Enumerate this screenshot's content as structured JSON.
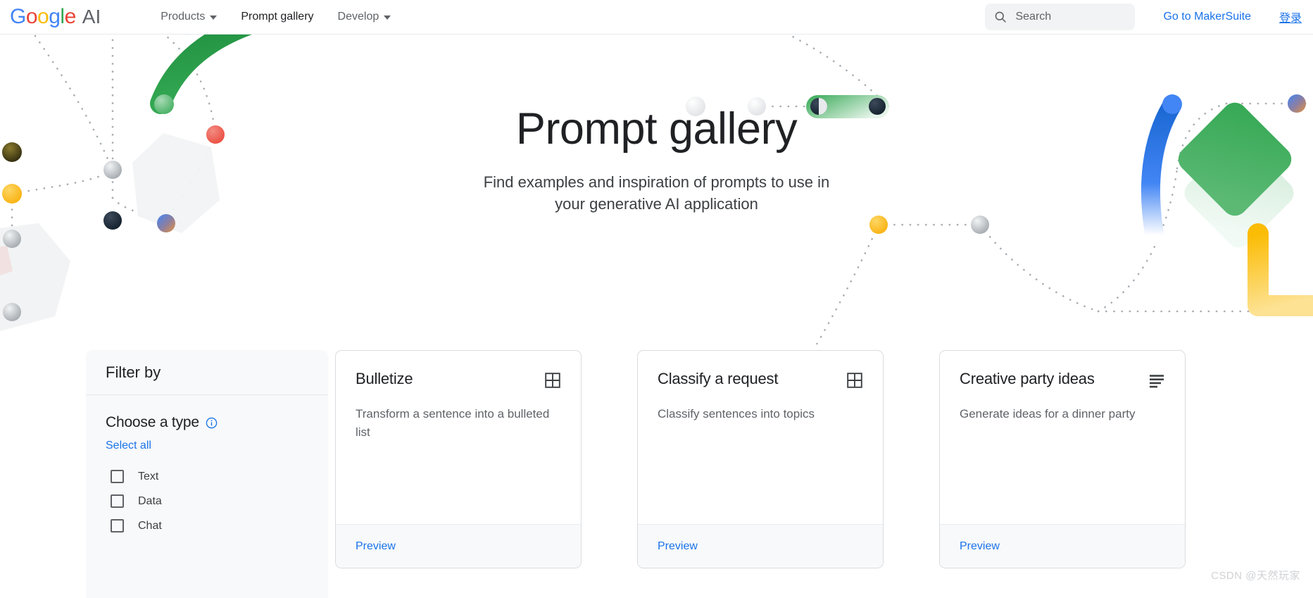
{
  "header": {
    "logo": {
      "text": "Google",
      "suffix": "AI"
    },
    "nav": [
      {
        "label": "Products",
        "has_caret": true,
        "active": false
      },
      {
        "label": "Prompt gallery",
        "has_caret": false,
        "active": true
      },
      {
        "label": "Develop",
        "has_caret": true,
        "active": false
      }
    ],
    "search": {
      "placeholder": "Search",
      "value": "",
      "icon": "search-icon"
    },
    "makersuite_label": "Go to MakerSuite",
    "signin_label": "登录"
  },
  "hero": {
    "title": "Prompt gallery",
    "subtitle_line1": "Find examples and inspiration of prompts to use in",
    "subtitle_line2": "your generative AI application"
  },
  "filter": {
    "heading": "Filter by",
    "choose_type_label": "Choose a type",
    "info_icon": "info-icon",
    "select_all_label": "Select all",
    "options": [
      {
        "label": "Text",
        "checked": false
      },
      {
        "label": "Data",
        "checked": false
      },
      {
        "label": "Chat",
        "checked": false
      }
    ]
  },
  "cards": [
    {
      "title": "Bulletize",
      "description": "Transform a sentence into a bulleted list",
      "icon": "grid-2x2-icon",
      "action_label": "Preview"
    },
    {
      "title": "Classify a request",
      "description": "Classify sentences into topics",
      "icon": "grid-2x2-icon",
      "action_label": "Preview"
    },
    {
      "title": "Creative party ideas",
      "description": "Generate ideas for a dinner party",
      "icon": "text-lines-icon",
      "action_label": "Preview"
    }
  ],
  "watermark": "CSDN @天然玩家",
  "colors": {
    "link_blue": "#1a73e8",
    "google_blue": "#4285F4",
    "google_red": "#EA4335",
    "google_yellow": "#FBBC05",
    "google_green": "#34A853",
    "text_primary": "#202124",
    "text_secondary": "#5f6368",
    "panel_bg": "#f8f9fa",
    "border": "#dadce0"
  }
}
